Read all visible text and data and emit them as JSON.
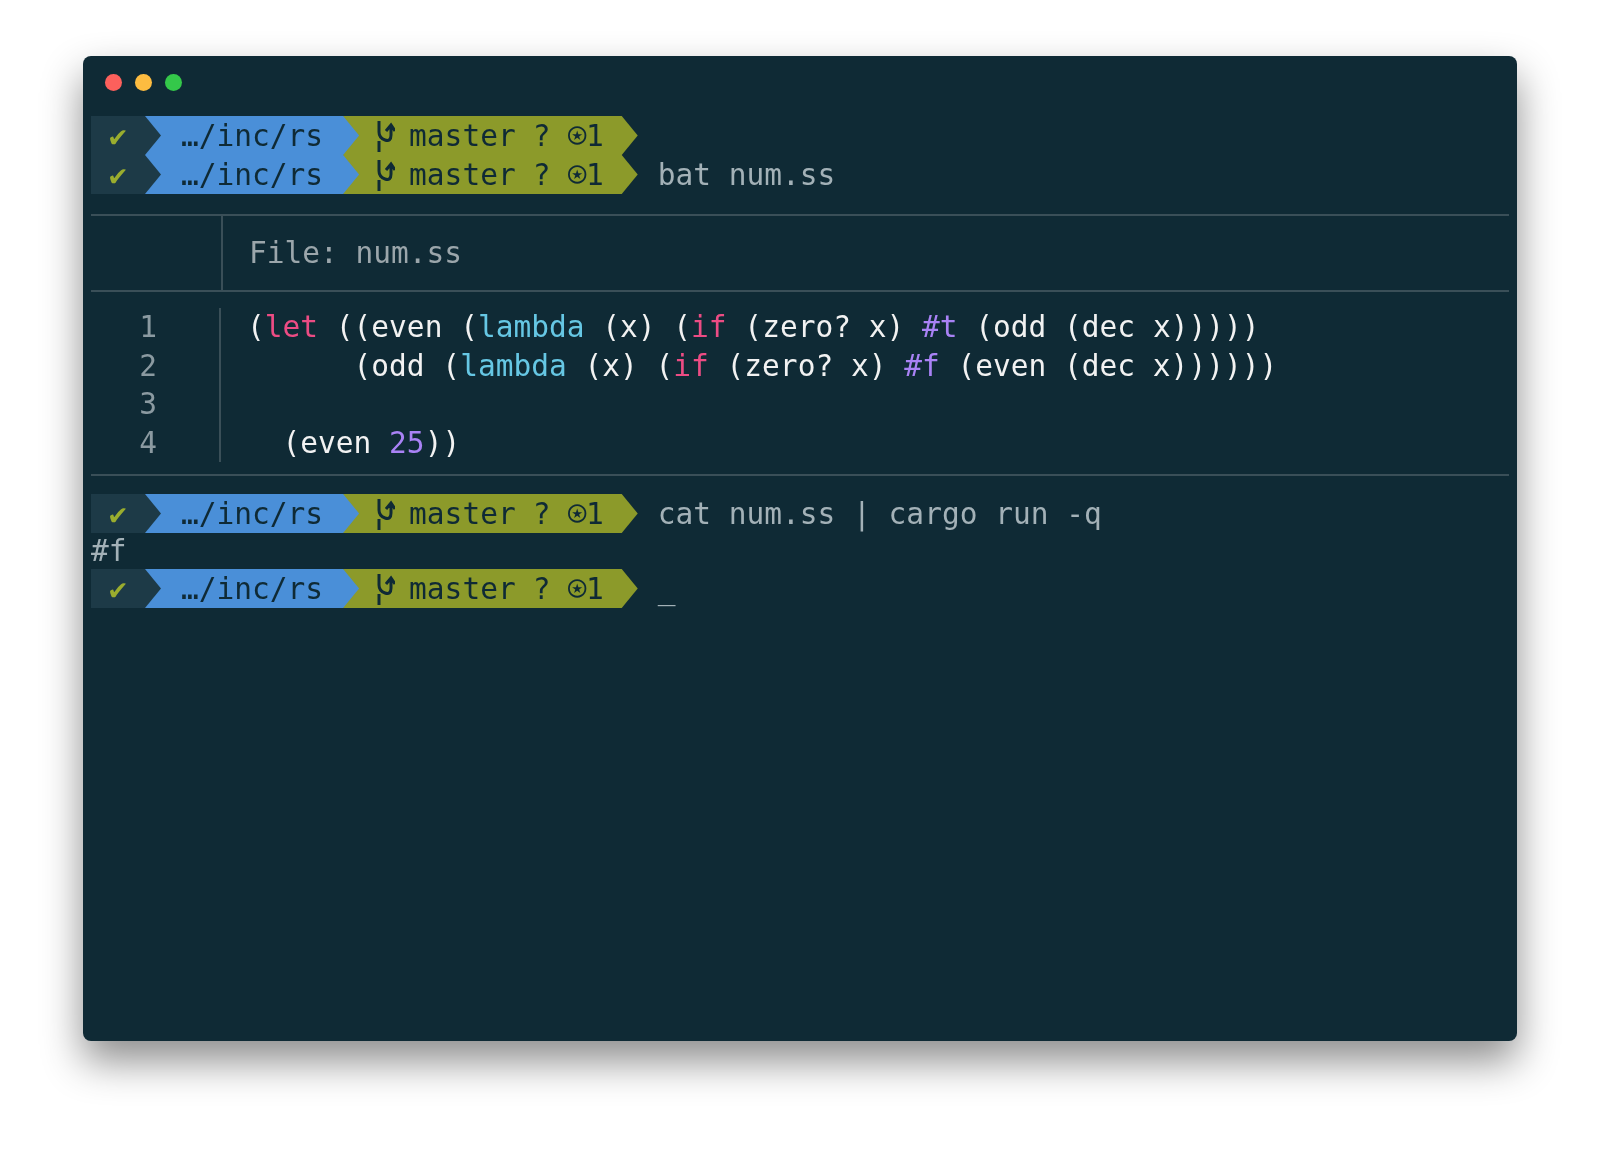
{
  "window": {
    "controls": [
      {
        "color": "#fc605c"
      },
      {
        "color": "#fdbc40"
      },
      {
        "color": "#34c84a"
      }
    ]
  },
  "terminal": [
    {
      "kind": "prompt",
      "status": "✔",
      "path": "…/inc/rs",
      "branch": "master",
      "git_status": "? ⍟1"
    },
    {
      "kind": "prompt",
      "status": "✔",
      "path": "…/inc/rs",
      "branch": "master",
      "git_status": "? ⍟1",
      "command": "bat num.ss"
    },
    {
      "kind": "file",
      "header": "File: num.ss",
      "lines": [
        {
          "number": "1",
          "tokens": [
            {
              "kind": "plain",
              "text": "("
            },
            {
              "kind": "keyword",
              "text": "let"
            },
            {
              "kind": "plain",
              "text": " ((even ("
            },
            {
              "kind": "builtin",
              "text": "lambda"
            },
            {
              "kind": "plain",
              "text": " (x) ("
            },
            {
              "kind": "keyword",
              "text": "if"
            },
            {
              "kind": "plain",
              "text": " (zero? x) "
            },
            {
              "kind": "constant",
              "text": "#t"
            },
            {
              "kind": "plain",
              "text": " (odd (dec x)))))"
            }
          ]
        },
        {
          "number": "2",
          "tokens": [
            {
              "kind": "plain",
              "text": "      (odd ("
            },
            {
              "kind": "builtin",
              "text": "lambda"
            },
            {
              "kind": "plain",
              "text": " (x) ("
            },
            {
              "kind": "keyword",
              "text": "if"
            },
            {
              "kind": "plain",
              "text": " (zero? x) "
            },
            {
              "kind": "constant",
              "text": "#f"
            },
            {
              "kind": "plain",
              "text": " (even (dec x))))))"
            }
          ]
        },
        {
          "number": "3"
        },
        {
          "number": "4",
          "tokens": [
            {
              "kind": "plain",
              "text": "  (even "
            },
            {
              "kind": "constant",
              "text": "25"
            },
            {
              "kind": "plain",
              "text": "))"
            }
          ]
        }
      ]
    },
    {
      "kind": "prompt",
      "status": "✔",
      "path": "…/inc/rs",
      "branch": "master",
      "git_status": "? ⍟1",
      "command": "cat num.ss | cargo run -q"
    },
    {
      "kind": "output",
      "text": "#f"
    },
    {
      "kind": "prompt",
      "status": "✔",
      "path": "…/inc/rs",
      "branch": "master",
      "git_status": "? ⍟1",
      "cursor": "_"
    }
  ]
}
